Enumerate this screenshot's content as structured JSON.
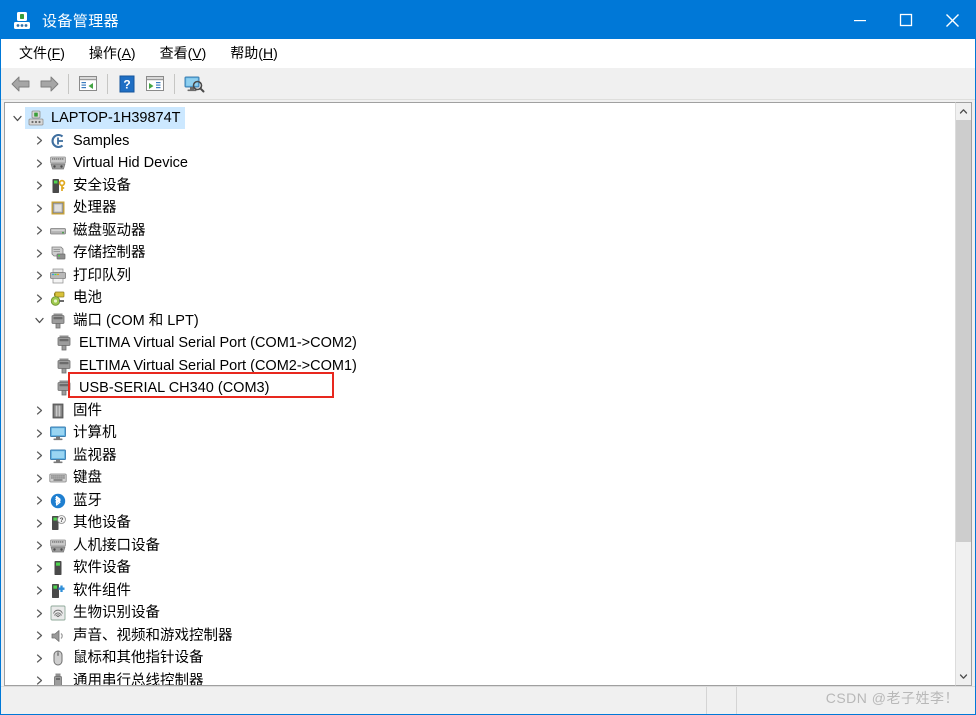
{
  "window": {
    "title": "设备管理器",
    "icon": "device-manager-icon",
    "accent_color": "#0078d7",
    "controls": [
      {
        "name": "minimize",
        "glyph": "minimize-icon"
      },
      {
        "name": "maximize",
        "glyph": "maximize-icon"
      },
      {
        "name": "close",
        "glyph": "close-icon"
      }
    ]
  },
  "menubar": {
    "items": [
      {
        "label": "文件",
        "accel": "F"
      },
      {
        "label": "操作",
        "accel": "A"
      },
      {
        "label": "查看",
        "accel": "V"
      },
      {
        "label": "帮助",
        "accel": "H"
      }
    ]
  },
  "toolbar": {
    "buttons": [
      {
        "name": "back",
        "icon": "back-arrow-icon"
      },
      {
        "name": "forward",
        "icon": "forward-arrow-icon"
      },
      {
        "name": "properties",
        "icon": "properties-window-icon"
      },
      {
        "name": "help",
        "icon": "help-question-icon"
      },
      {
        "name": "update-driver",
        "icon": "window-play-icon"
      },
      {
        "name": "scan-hardware",
        "icon": "scan-monitor-icon"
      }
    ]
  },
  "tree": {
    "root": {
      "label": "LAPTOP-1H39874T",
      "icon": "computer-icon",
      "expanded": true,
      "selected": true
    },
    "nodes": [
      {
        "label": "Samples",
        "icon": "samples-icon",
        "level": 1,
        "expanded": false
      },
      {
        "label": "Virtual Hid Device",
        "icon": "hid-device-icon",
        "level": 1,
        "expanded": false
      },
      {
        "label": "安全设备",
        "icon": "security-device-icon",
        "level": 1,
        "expanded": false
      },
      {
        "label": "处理器",
        "icon": "processor-icon",
        "level": 1,
        "expanded": false
      },
      {
        "label": "磁盘驱动器",
        "icon": "disk-drive-icon",
        "level": 1,
        "expanded": false
      },
      {
        "label": "存储控制器",
        "icon": "storage-controller-icon",
        "level": 1,
        "expanded": false
      },
      {
        "label": "打印队列",
        "icon": "print-queue-icon",
        "level": 1,
        "expanded": false
      },
      {
        "label": "电池",
        "icon": "battery-icon",
        "level": 1,
        "expanded": false
      },
      {
        "label": "端口 (COM 和 LPT)",
        "icon": "ports-icon",
        "level": 1,
        "expanded": true
      },
      {
        "label": "ELTIMA Virtual Serial Port (COM1->COM2)",
        "icon": "serial-port-icon",
        "level": 2,
        "expanded": null
      },
      {
        "label": "ELTIMA Virtual Serial Port (COM2->COM1)",
        "icon": "serial-port-icon",
        "level": 2,
        "expanded": null
      },
      {
        "label": "USB-SERIAL CH340 (COM3)",
        "icon": "serial-port-icon",
        "level": 2,
        "expanded": null,
        "highlighted": true
      },
      {
        "label": "固件",
        "icon": "firmware-icon",
        "level": 1,
        "expanded": false
      },
      {
        "label": "计算机",
        "icon": "computer-monitor-icon",
        "level": 1,
        "expanded": false
      },
      {
        "label": "监视器",
        "icon": "monitor-icon",
        "level": 1,
        "expanded": false
      },
      {
        "label": "键盘",
        "icon": "keyboard-icon",
        "level": 1,
        "expanded": false
      },
      {
        "label": "蓝牙",
        "icon": "bluetooth-icon",
        "level": 1,
        "expanded": false
      },
      {
        "label": "其他设备",
        "icon": "other-device-icon",
        "level": 1,
        "expanded": false
      },
      {
        "label": "人机接口设备",
        "icon": "hid-device-icon",
        "level": 1,
        "expanded": false
      },
      {
        "label": "软件设备",
        "icon": "software-device-icon",
        "level": 1,
        "expanded": false
      },
      {
        "label": "软件组件",
        "icon": "software-component-icon",
        "level": 1,
        "expanded": false
      },
      {
        "label": "生物识别设备",
        "icon": "biometric-icon",
        "level": 1,
        "expanded": false
      },
      {
        "label": "声音、视频和游戏控制器",
        "icon": "sound-icon",
        "level": 1,
        "expanded": false
      },
      {
        "label": "鼠标和其他指针设备",
        "icon": "mouse-icon",
        "level": 1,
        "expanded": false
      },
      {
        "label": "通用串行总线控制器",
        "icon": "usb-controller-icon",
        "level": 1,
        "expanded": false
      }
    ],
    "highlight_color": "#e8281e",
    "selection_color": "#cce8ff"
  },
  "scrollbar": {
    "up_arrow": "chevron-up-icon",
    "down_arrow": "chevron-down-icon"
  },
  "statusbar": {
    "text": ""
  },
  "watermark": {
    "text": "CSDN @老子姓李！"
  }
}
